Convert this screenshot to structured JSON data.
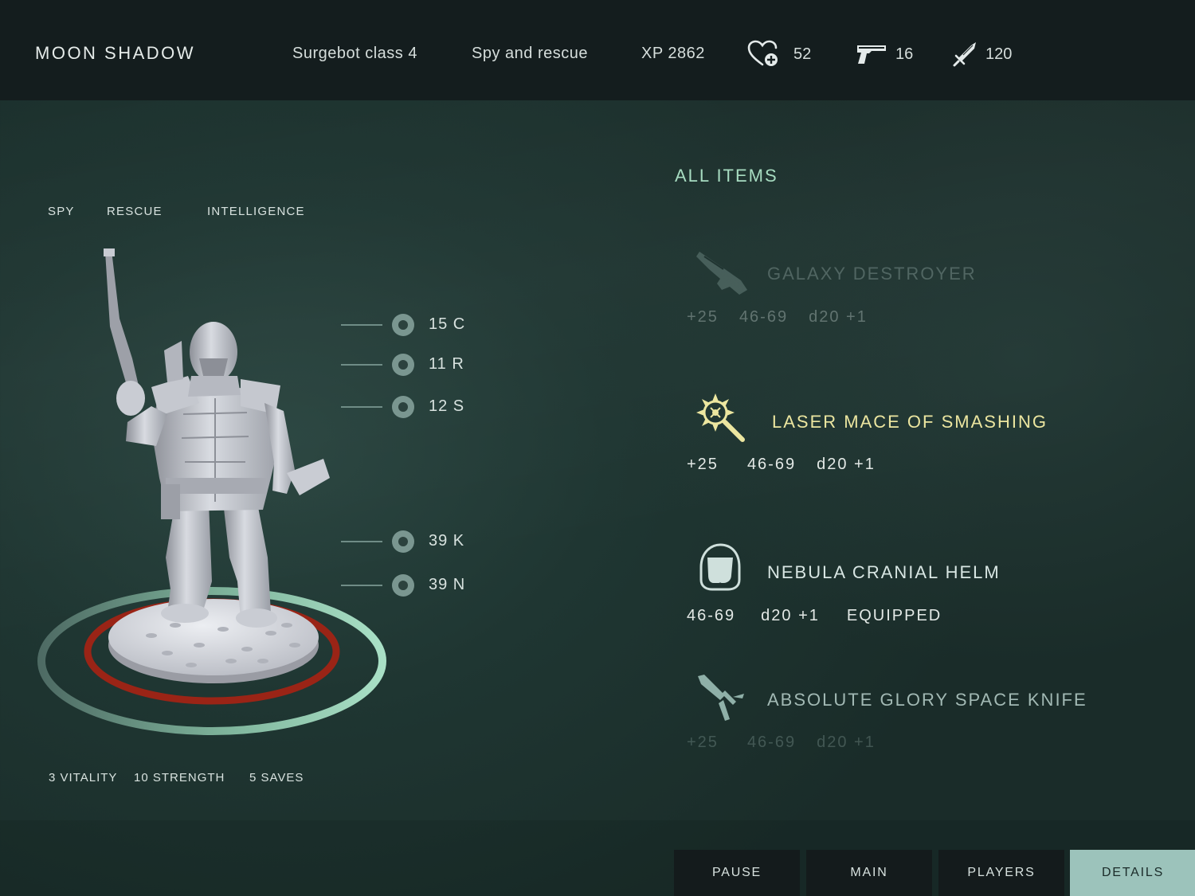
{
  "header": {
    "title": "MOON SHADOW",
    "class": "Surgebot class 4",
    "role": "Spy and rescue",
    "xp": "XP 2862",
    "stats": [
      {
        "icon": "heart-plus-icon",
        "value": "52"
      },
      {
        "icon": "pistol-icon",
        "value": "16"
      },
      {
        "icon": "sword-icon",
        "value": "120"
      }
    ]
  },
  "character": {
    "tabs": [
      "SPY",
      "RESCUE",
      "INTELLIGENCE"
    ],
    "markers": [
      "15 C",
      "11 R",
      "12 S",
      "39 K",
      "39 N"
    ],
    "bottom_stats": [
      "3 VITALITY",
      "10 STRENGTH",
      "5 SAVES"
    ]
  },
  "items": {
    "title": "ALL ITEMS",
    "list": [
      {
        "name": "GALAXY DESTROYER",
        "icon": "blaster-icon",
        "attrs": [
          "+25",
          "46-69",
          "d20 +1"
        ],
        "state": "dim"
      },
      {
        "name": "LASER MACE OF SMASHING",
        "icon": "mace-icon",
        "attrs": [
          "+25",
          "46-69",
          "d20 +1"
        ],
        "state": "highlight"
      },
      {
        "name": "NEBULA CRANIAL HELM",
        "icon": "helmet-icon",
        "attrs": [
          "46-69",
          "d20 +1",
          "EQUIPPED"
        ],
        "state": "normal"
      },
      {
        "name": "ABSOLUTE GLORY SPACE KNIFE",
        "icon": "knife-icon",
        "attrs": [
          "+25",
          "46-69",
          "d20 +1"
        ],
        "state": "faded"
      }
    ]
  },
  "nav": {
    "buttons": [
      "PAUSE",
      "MAIN",
      "PLAYERS",
      "DETAILS"
    ],
    "active": "DETAILS"
  },
  "colors": {
    "accent_green": "#a7dcc1",
    "highlight_yellow": "#ece6a0",
    "ring_red": "#9a2416",
    "nav_active": "#9cc3bb"
  }
}
